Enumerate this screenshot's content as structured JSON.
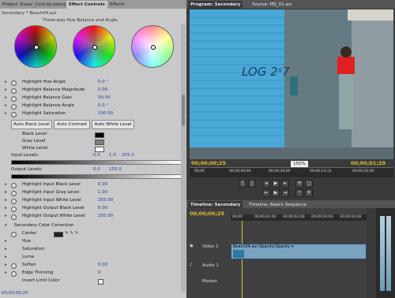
{
  "left_panel": {
    "tabs": [
      "Project: Dvasr_Color2p.prproj",
      "Effect Controls",
      "Effects"
    ],
    "header": "Secondary * Beach04.avi",
    "wheel_title": "Three-way Hue Balance and Angle",
    "params": [
      {
        "label": "Highlight Hue Angle",
        "value": "0.0 °"
      },
      {
        "label": "Highlight Balance Magnitude",
        "value": "0.00"
      },
      {
        "label": "Highlight Balance Gain",
        "value": "50.00"
      },
      {
        "label": "Highlight Balance Angle",
        "value": "0.0 °"
      },
      {
        "label": "Highlight Saturation",
        "value": "100.00"
      }
    ],
    "buttons": [
      "Auto Black Level",
      "Auto Contrast",
      "Auto White Level"
    ],
    "levels": [
      "Black Level",
      "Gray Level",
      "White Level"
    ],
    "input_levels_label": "Input Levels:",
    "input_levels_values": [
      "0.0",
      "1.0",
      "255.0"
    ],
    "output_levels_label": "Output Levels:",
    "output_levels_values": [
      "0.0",
      "255.0"
    ],
    "level_params": [
      {
        "label": "Highlight Input Black Level",
        "value": "0.00"
      },
      {
        "label": "Highlight Input Gray Level",
        "value": "1.00"
      },
      {
        "label": "Highlight Input White Level",
        "value": "255.00"
      },
      {
        "label": "Highlight Output Black Level",
        "value": "0.00"
      },
      {
        "label": "Highlight Output White Level",
        "value": "255.00"
      }
    ],
    "secondary": {
      "title": "Secondary Color Correction",
      "items": [
        "Center",
        "Hue",
        "Saturation",
        "Luma",
        "Soften",
        "Edge Thinning",
        "Invert Limit Color"
      ],
      "values": {
        "Soften": "0.00",
        "Edge Thinning": "0"
      }
    },
    "timecode": "00;00;00;25"
  },
  "program": {
    "tabs": [
      "Program: Secondary",
      "Source: PEJ_01.avi"
    ],
    "timecode_left": "00;00;00;25",
    "timecode_right": "00;00;01;29",
    "zoom": "150%",
    "ruler_times": [
      "00;00",
      "00;00;08;00",
      "00;00;16;00",
      "00;00;24;12",
      "00;00;32;00"
    ],
    "wall_text": "LOG 2ˢ7"
  },
  "timeline": {
    "tabs": [
      "Timeline: Secondary",
      "Timeline: Beach Sequence"
    ],
    "timecode": "00;00;00;25",
    "ruler_times": [
      "00;00",
      "00;00;01;00",
      "00;00;02;00",
      "00;00;03;00",
      "00;00;04;00"
    ],
    "tracks": [
      "Video 1",
      "Audio 1",
      "Master"
    ],
    "clip_label": "Beach04.avi Opacity:Opacity ▾"
  },
  "colors": {
    "accent": "#e0c030",
    "panel_bg": "#c9c9c9",
    "video_sky": "#4aa8d8"
  }
}
